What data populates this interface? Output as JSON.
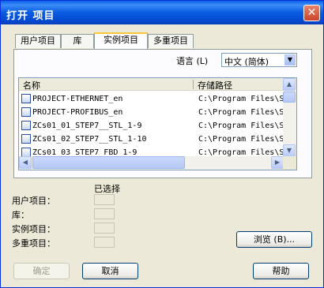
{
  "window": {
    "title": "打开 项目"
  },
  "tabs": [
    {
      "label": "用户项目",
      "active": false
    },
    {
      "label": "库",
      "active": false
    },
    {
      "label": "实例项目",
      "active": true
    },
    {
      "label": "多重项目",
      "active": false
    }
  ],
  "language": {
    "label": "语言 (L)",
    "selected": "中文 (简体)"
  },
  "list": {
    "columns": [
      "名称",
      "存储路径"
    ],
    "rows": [
      {
        "name": "PROJECT-ETHERNET_en",
        "path": "C:\\Program Files\\S"
      },
      {
        "name": "PROJECT-PROFIBUS_en",
        "path": "C:\\Program Files\\S"
      },
      {
        "name": "ZCs01_01_STEP7__STL_1-9",
        "path": "C:\\Program Files\\S"
      },
      {
        "name": "ZCs01_02_STEP7__STL_1-10",
        "path": "C:\\Program Files\\S"
      },
      {
        "name": "ZCs01 03 STEP7  FBD 1-9",
        "path": "C:\\Program Files\\S"
      }
    ]
  },
  "selected": {
    "title": "已选择",
    "labels": [
      "用户项目：",
      "库：",
      "实例项目：",
      "多重项目："
    ]
  },
  "buttons": {
    "browse": "浏览 (B)...",
    "ok": "确定",
    "cancel": "取消",
    "help": "帮助"
  }
}
